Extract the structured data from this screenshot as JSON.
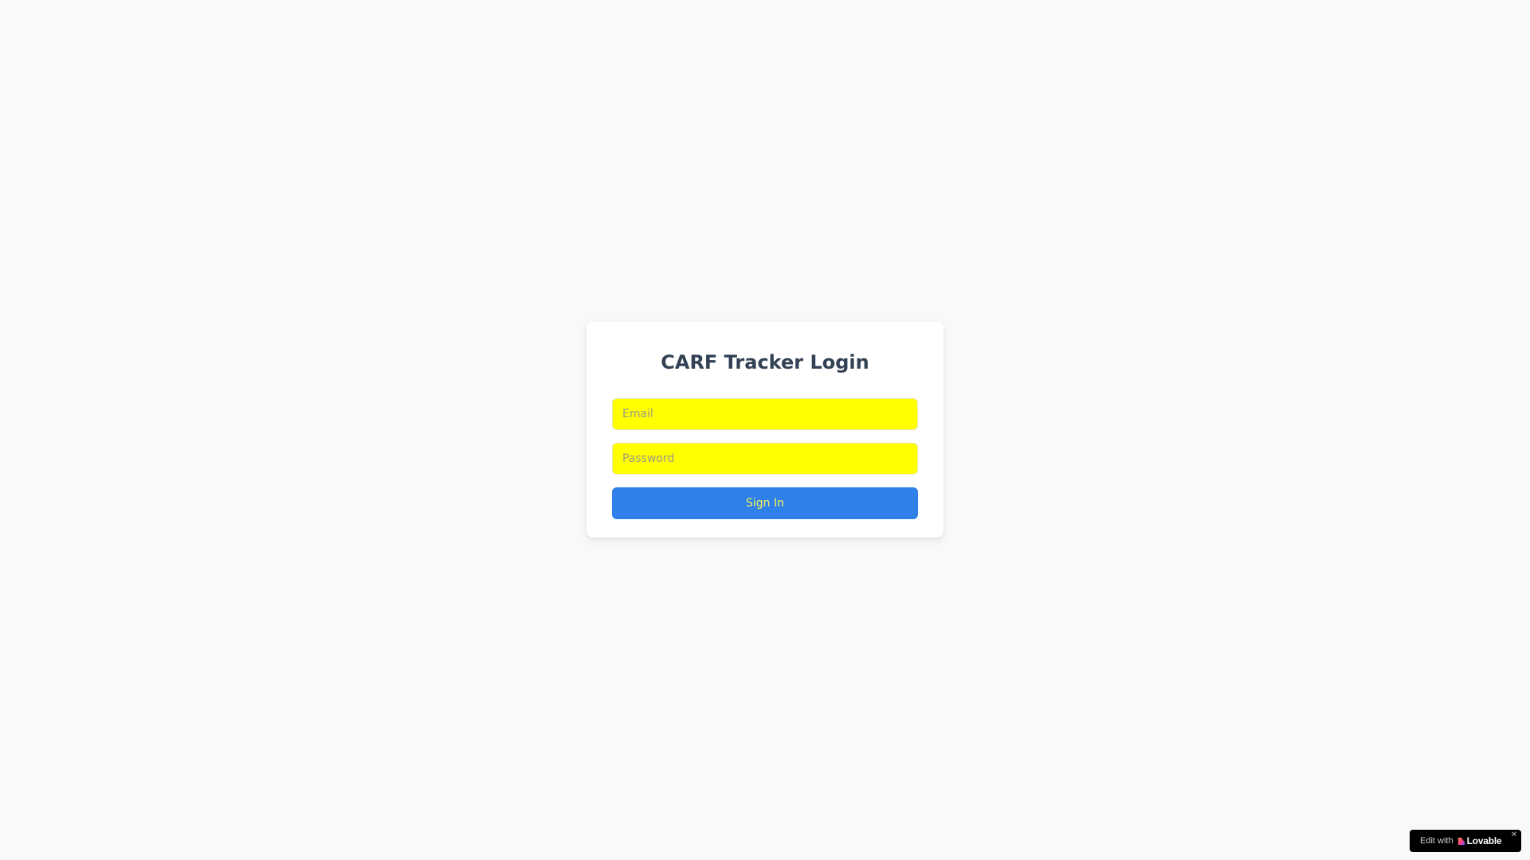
{
  "login": {
    "title": "CARF Tracker Login",
    "email_placeholder": "Email",
    "password_placeholder": "Password",
    "signin_label": "Sign In"
  },
  "badge": {
    "prefix": "Edit with",
    "brand": "Lovable",
    "close_icon": "close-icon",
    "logo_icon": "heart-icon"
  },
  "colors": {
    "background": "#f8f9fb",
    "card": "#ffffff",
    "title": "#334155",
    "input_background": "#ffff00",
    "button_background": "#3080ea",
    "button_text": "#f2f25a",
    "badge_background": "#000000"
  }
}
